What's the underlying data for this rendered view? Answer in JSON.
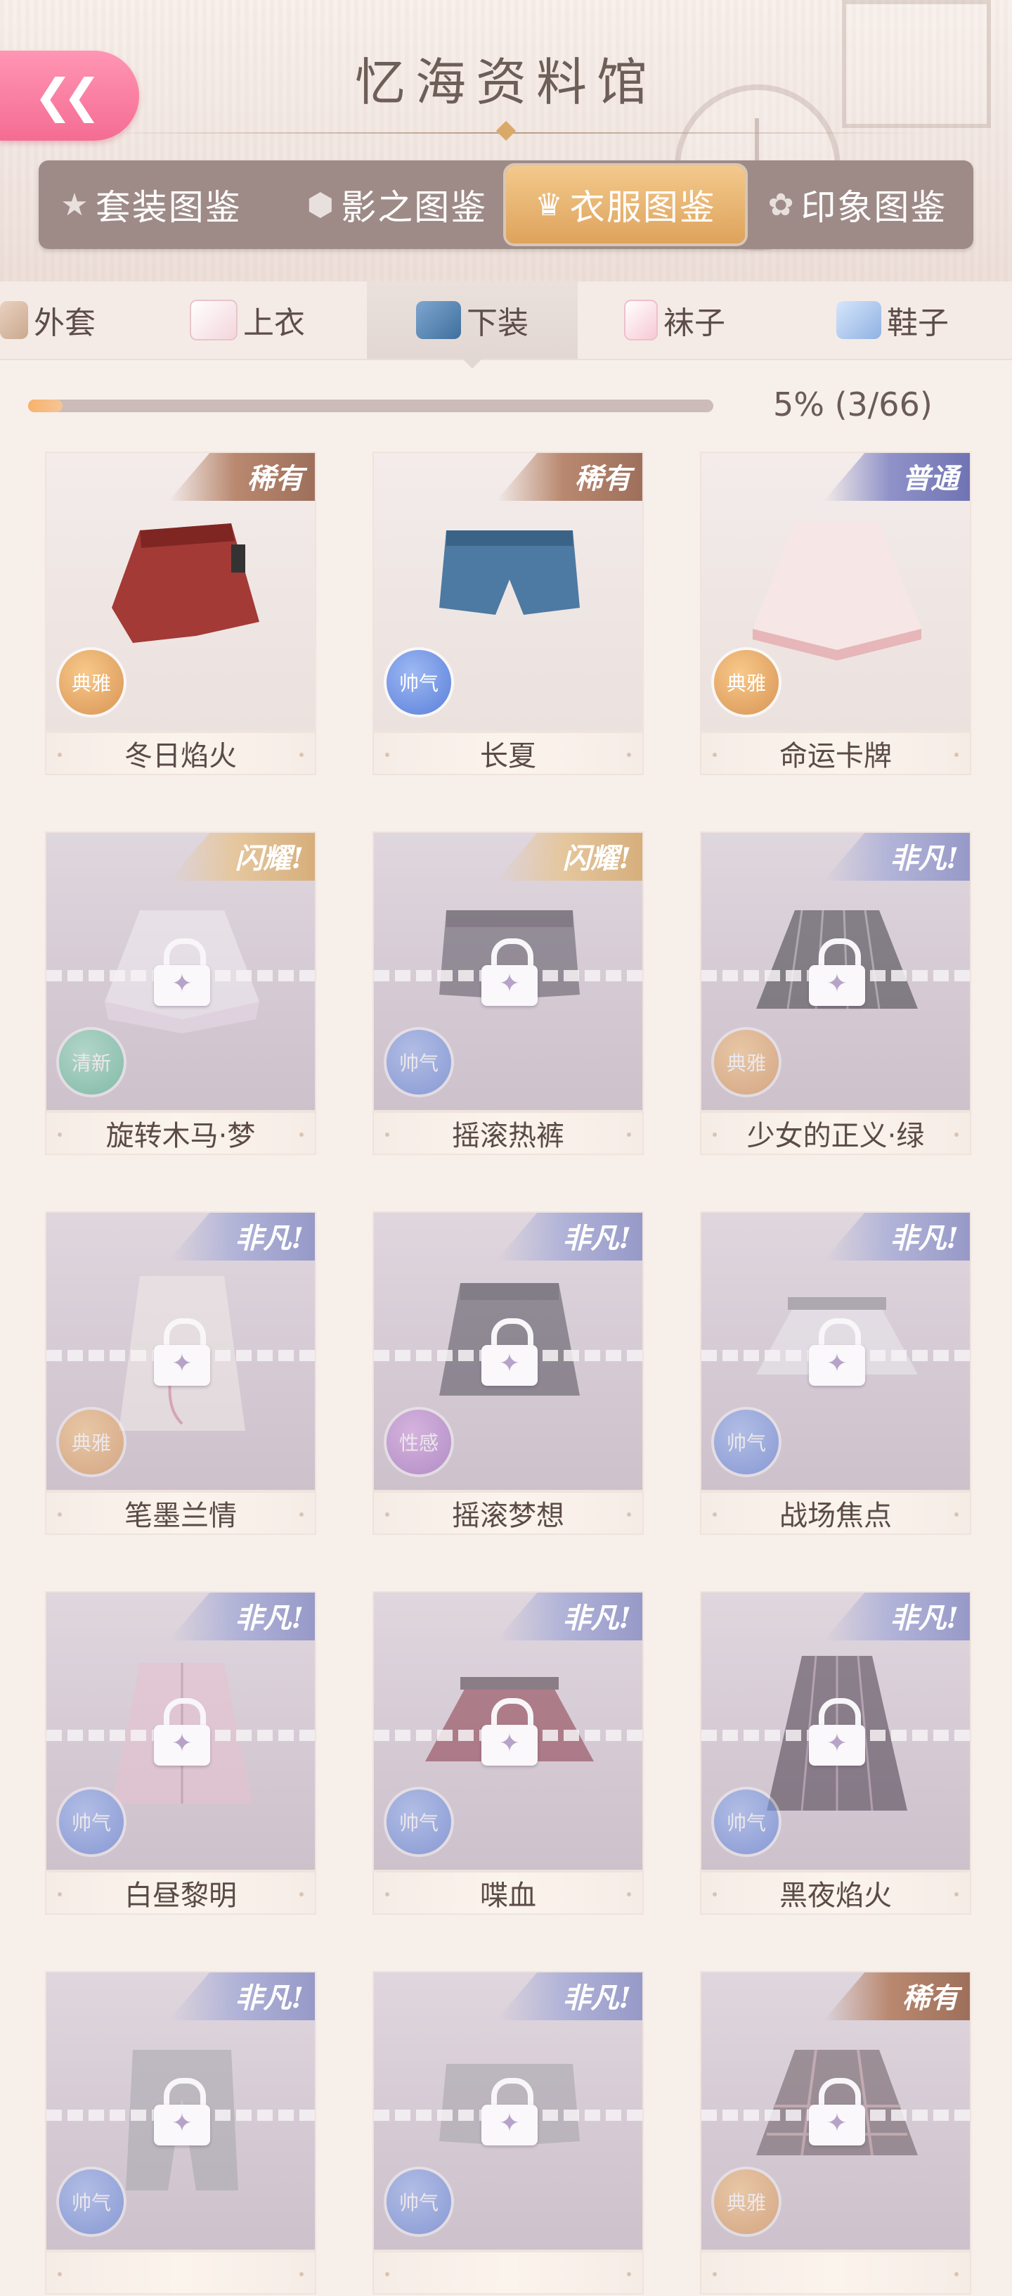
{
  "header": {
    "title": "忆海资料馆",
    "back_icon": "double-chevron-left-icon"
  },
  "categories": [
    {
      "label": "套装图鉴",
      "icon": "star-icon",
      "active": false
    },
    {
      "label": "影之图鉴",
      "icon": "cube-icon",
      "active": false
    },
    {
      "label": "衣服图鉴",
      "icon": "dress-icon",
      "active": true
    },
    {
      "label": "印象图鉴",
      "icon": "flower-icon",
      "active": false
    }
  ],
  "subtabs": [
    {
      "label": "外套",
      "icon": "coat-icon",
      "active": false
    },
    {
      "label": "上衣",
      "icon": "shirt-icon",
      "active": false
    },
    {
      "label": "下装",
      "icon": "shorts-icon",
      "active": true
    },
    {
      "label": "袜子",
      "icon": "sock-icon",
      "active": false
    },
    {
      "label": "鞋子",
      "icon": "shoe-icon",
      "active": false
    }
  ],
  "progress": {
    "text": "5% (3/66)",
    "fraction": 0.05
  },
  "colors": {
    "accent": "#f56c93",
    "active_tab": "#dea35c",
    "rare": "#b9886f",
    "common": "#8f92c8"
  },
  "items": [
    {
      "name": "冬日焰火",
      "rarity": "稀有",
      "style": "典雅",
      "locked": false,
      "garment": "red-skirt"
    },
    {
      "name": "长夏",
      "rarity": "稀有",
      "style": "帅气",
      "locked": false,
      "garment": "denim-shorts"
    },
    {
      "name": "命运卡牌",
      "rarity": "普通",
      "style": "典雅",
      "locked": false,
      "garment": "white-skirt"
    },
    {
      "name": "旋转木马·梦",
      "rarity": "闪耀!",
      "style": "清新",
      "locked": true,
      "garment": "ruffle-skirt"
    },
    {
      "name": "摇滚热裤",
      "rarity": "闪耀!",
      "style": "帅气",
      "locked": true,
      "garment": "leather-shorts"
    },
    {
      "name": "少女的正义·绿",
      "rarity": "非凡!",
      "style": "典雅",
      "locked": true,
      "garment": "pleated-skirt"
    },
    {
      "name": "笔墨兰情",
      "rarity": "非凡!",
      "style": "典雅",
      "locked": true,
      "garment": "long-skirt"
    },
    {
      "name": "摇滚梦想",
      "rarity": "非凡!",
      "style": "性感",
      "locked": true,
      "garment": "leather-skirt"
    },
    {
      "name": "战场焦点",
      "rarity": "非凡!",
      "style": "帅气",
      "locked": true,
      "garment": "white-pleated"
    },
    {
      "name": "白昼黎明",
      "rarity": "非凡!",
      "style": "帅气",
      "locked": true,
      "garment": "pink-skirt"
    },
    {
      "name": "喋血",
      "rarity": "非凡!",
      "style": "帅气",
      "locked": true,
      "garment": "maroon-pleated"
    },
    {
      "name": "黑夜焰火",
      "rarity": "非凡!",
      "style": "帅气",
      "locked": true,
      "garment": "stripe-long"
    },
    {
      "name": "",
      "rarity": "非凡!",
      "style": "帅气",
      "locked": true,
      "garment": "grey-pants"
    },
    {
      "name": "",
      "rarity": "非凡!",
      "style": "帅气",
      "locked": true,
      "garment": "grey-shorts"
    },
    {
      "name": "",
      "rarity": "稀有",
      "style": "典雅",
      "locked": true,
      "garment": "plaid-skirt"
    }
  ]
}
